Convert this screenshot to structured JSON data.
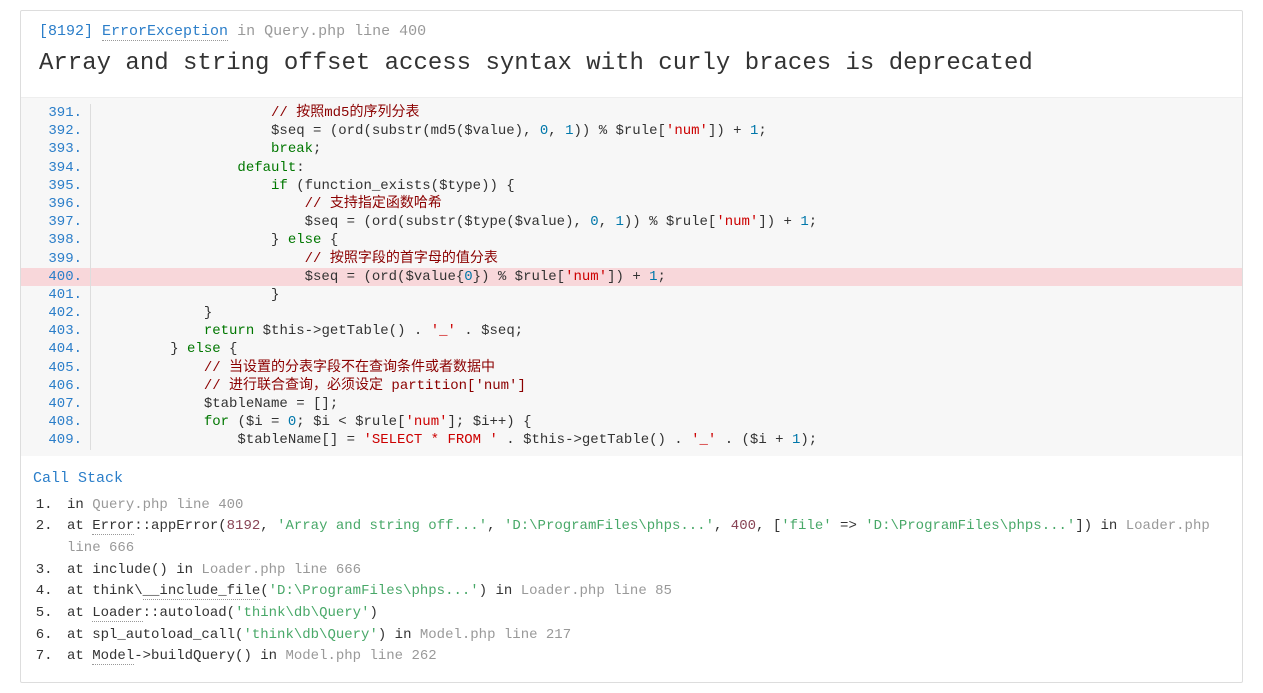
{
  "header": {
    "code": "[8192]",
    "className": "ErrorException",
    "inWord": "in",
    "fileLoc": "Query.php line 400",
    "message": "Array and string offset access syntax with curly braces is deprecated"
  },
  "code": {
    "highlightLine": 400,
    "lines": [
      {
        "n": 391,
        "segs": [
          {
            "t": "                    ",
            "c": ""
          },
          {
            "t": "// 按照md5的序列分表",
            "c": "c-comment"
          }
        ]
      },
      {
        "n": 392,
        "segs": [
          {
            "t": "                    $seq = (ord(substr(md5($value), ",
            "c": ""
          },
          {
            "t": "0",
            "c": "c-num"
          },
          {
            "t": ", ",
            "c": ""
          },
          {
            "t": "1",
            "c": "c-num"
          },
          {
            "t": ")) % $rule[",
            "c": ""
          },
          {
            "t": "'num'",
            "c": "c-string"
          },
          {
            "t": "]) + ",
            "c": ""
          },
          {
            "t": "1",
            "c": "c-num"
          },
          {
            "t": ";",
            "c": ""
          }
        ]
      },
      {
        "n": 393,
        "segs": [
          {
            "t": "                    ",
            "c": ""
          },
          {
            "t": "break",
            "c": "c-keyword"
          },
          {
            "t": ";",
            "c": ""
          }
        ]
      },
      {
        "n": 394,
        "segs": [
          {
            "t": "                ",
            "c": ""
          },
          {
            "t": "default",
            "c": "c-keyword"
          },
          {
            "t": ":",
            "c": ""
          }
        ]
      },
      {
        "n": 395,
        "segs": [
          {
            "t": "                    ",
            "c": ""
          },
          {
            "t": "if",
            "c": "c-keyword"
          },
          {
            "t": " (function_exists($type)) {",
            "c": ""
          }
        ]
      },
      {
        "n": 396,
        "segs": [
          {
            "t": "                        ",
            "c": ""
          },
          {
            "t": "// 支持指定函数哈希",
            "c": "c-comment"
          }
        ]
      },
      {
        "n": 397,
        "segs": [
          {
            "t": "                        $seq = (ord(substr($type($value), ",
            "c": ""
          },
          {
            "t": "0",
            "c": "c-num"
          },
          {
            "t": ", ",
            "c": ""
          },
          {
            "t": "1",
            "c": "c-num"
          },
          {
            "t": ")) % $rule[",
            "c": ""
          },
          {
            "t": "'num'",
            "c": "c-string"
          },
          {
            "t": "]) + ",
            "c": ""
          },
          {
            "t": "1",
            "c": "c-num"
          },
          {
            "t": ";",
            "c": ""
          }
        ]
      },
      {
        "n": 398,
        "segs": [
          {
            "t": "                    } ",
            "c": ""
          },
          {
            "t": "else",
            "c": "c-keyword"
          },
          {
            "t": " {",
            "c": ""
          }
        ]
      },
      {
        "n": 399,
        "segs": [
          {
            "t": "                        ",
            "c": ""
          },
          {
            "t": "// 按照字段的首字母的值分表",
            "c": "c-comment"
          }
        ]
      },
      {
        "n": 400,
        "segs": [
          {
            "t": "                        $seq = (ord($value{",
            "c": ""
          },
          {
            "t": "0",
            "c": "c-num"
          },
          {
            "t": "}) % $rule[",
            "c": ""
          },
          {
            "t": "'num'",
            "c": "c-string"
          },
          {
            "t": "]) + ",
            "c": ""
          },
          {
            "t": "1",
            "c": "c-num"
          },
          {
            "t": ";",
            "c": ""
          }
        ]
      },
      {
        "n": 401,
        "segs": [
          {
            "t": "                    }",
            "c": ""
          }
        ]
      },
      {
        "n": 402,
        "segs": [
          {
            "t": "            }",
            "c": ""
          }
        ]
      },
      {
        "n": 403,
        "segs": [
          {
            "t": "            ",
            "c": ""
          },
          {
            "t": "return",
            "c": "c-keyword"
          },
          {
            "t": " $this->getTable() . ",
            "c": ""
          },
          {
            "t": "'_'",
            "c": "c-string"
          },
          {
            "t": " . $seq;",
            "c": ""
          }
        ]
      },
      {
        "n": 404,
        "segs": [
          {
            "t": "        } ",
            "c": ""
          },
          {
            "t": "else",
            "c": "c-keyword"
          },
          {
            "t": " {",
            "c": ""
          }
        ]
      },
      {
        "n": 405,
        "segs": [
          {
            "t": "            ",
            "c": ""
          },
          {
            "t": "// 当设置的分表字段不在查询条件或者数据中",
            "c": "c-comment"
          }
        ]
      },
      {
        "n": 406,
        "segs": [
          {
            "t": "            ",
            "c": ""
          },
          {
            "t": "// 进行联合查询，必须设定 partition['num']",
            "c": "c-comment"
          }
        ]
      },
      {
        "n": 407,
        "segs": [
          {
            "t": "            $tableName = [];",
            "c": ""
          }
        ]
      },
      {
        "n": 408,
        "segs": [
          {
            "t": "            ",
            "c": ""
          },
          {
            "t": "for",
            "c": "c-keyword"
          },
          {
            "t": " ($i = ",
            "c": ""
          },
          {
            "t": "0",
            "c": "c-num"
          },
          {
            "t": "; $i < $rule[",
            "c": ""
          },
          {
            "t": "'num'",
            "c": "c-string"
          },
          {
            "t": "]; $i++) {",
            "c": ""
          }
        ]
      },
      {
        "n": 409,
        "segs": [
          {
            "t": "                $tableName[] = ",
            "c": ""
          },
          {
            "t": "'SELECT * FROM '",
            "c": "c-string"
          },
          {
            "t": " . $this->getTable() . ",
            "c": ""
          },
          {
            "t": "'_'",
            "c": "c-string"
          },
          {
            "t": " . ($i + ",
            "c": ""
          },
          {
            "t": "1",
            "c": "c-num"
          },
          {
            "t": ");",
            "c": ""
          }
        ]
      }
    ]
  },
  "sections": {
    "callStack": "Call Stack"
  },
  "stack": [
    {
      "segs": [
        {
          "t": "in ",
          "c": ""
        },
        {
          "t": "Query.php line 400",
          "c": "muted"
        }
      ]
    },
    {
      "segs": [
        {
          "t": "at ",
          "c": ""
        },
        {
          "t": "Error",
          "c": "dotted"
        },
        {
          "t": "::appError(",
          "c": ""
        },
        {
          "t": "8192",
          "c": "snum"
        },
        {
          "t": ", ",
          "c": ""
        },
        {
          "t": "'Array and string off...'",
          "c": "sarg"
        },
        {
          "t": ", ",
          "c": ""
        },
        {
          "t": "'D:\\ProgramFiles\\phps...'",
          "c": "sarg"
        },
        {
          "t": ", ",
          "c": ""
        },
        {
          "t": "400",
          "c": "snum"
        },
        {
          "t": ", [",
          "c": ""
        },
        {
          "t": "'file'",
          "c": "sarg"
        },
        {
          "t": " => ",
          "c": ""
        },
        {
          "t": "'D:\\ProgramFiles\\phps...'",
          "c": "sarg"
        },
        {
          "t": "]) in ",
          "c": ""
        },
        {
          "t": "Loader.php line 666",
          "c": "muted"
        }
      ]
    },
    {
      "segs": [
        {
          "t": "at include() in ",
          "c": ""
        },
        {
          "t": "Loader.php line 666",
          "c": "muted"
        }
      ]
    },
    {
      "segs": [
        {
          "t": "at think\\",
          "c": ""
        },
        {
          "t": "__include_file",
          "c": "dotted"
        },
        {
          "t": "(",
          "c": ""
        },
        {
          "t": "'D:\\ProgramFiles\\phps...'",
          "c": "sarg"
        },
        {
          "t": ") in ",
          "c": ""
        },
        {
          "t": "Loader.php line 85",
          "c": "muted"
        }
      ]
    },
    {
      "segs": [
        {
          "t": "at ",
          "c": ""
        },
        {
          "t": "Loader",
          "c": "dotted"
        },
        {
          "t": "::autoload(",
          "c": ""
        },
        {
          "t": "'think\\db\\Query'",
          "c": "sarg"
        },
        {
          "t": ")",
          "c": ""
        }
      ]
    },
    {
      "segs": [
        {
          "t": "at spl_autoload_call(",
          "c": ""
        },
        {
          "t": "'think\\db\\Query'",
          "c": "sarg"
        },
        {
          "t": ") in ",
          "c": ""
        },
        {
          "t": "Model.php line 217",
          "c": "muted"
        }
      ]
    },
    {
      "segs": [
        {
          "t": "at ",
          "c": ""
        },
        {
          "t": "Model",
          "c": "dotted"
        },
        {
          "t": "->buildQuery() in ",
          "c": ""
        },
        {
          "t": "Model.php line 262",
          "c": "muted"
        }
      ]
    }
  ]
}
